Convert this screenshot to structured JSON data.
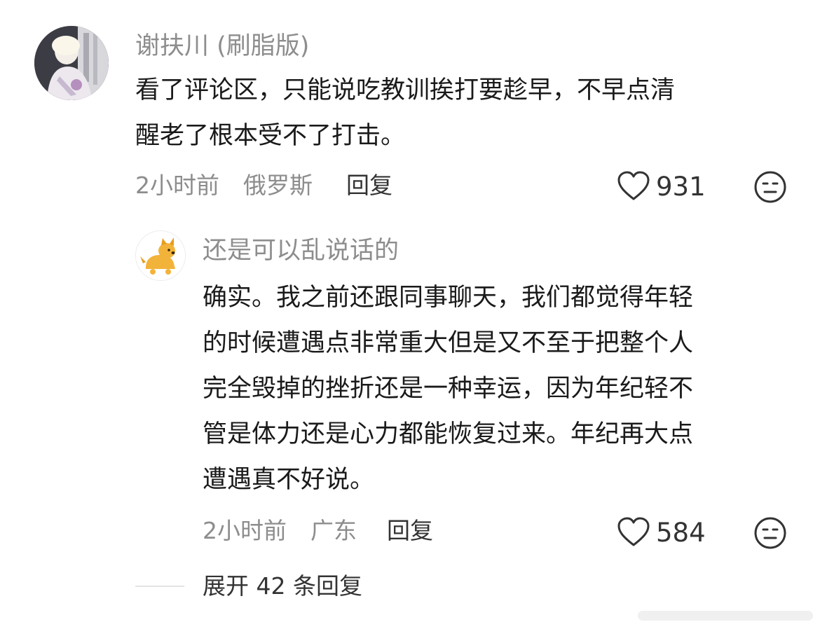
{
  "comments": [
    {
      "username": "谢扶川 (刷脂版)",
      "text_lines": [
        "看了评论区，只能说吃教训挨打要趁早，不早点清",
        "醒老了根本受不了打击。"
      ],
      "time": "2小时前",
      "location": "俄罗斯",
      "reply_label": "回复",
      "likes": "931",
      "like_icon": "heart-outline-icon",
      "reaction_icon": "neutral-face-icon"
    },
    {
      "username": "还是可以乱说话的",
      "text_lines": [
        "确实。我之前还跟同事聊天，我们都觉得年轻",
        "的时候遭遇点非常重大但是又不至于把整个人",
        "完全毁掉的挫折还是一种幸运，因为年纪轻不",
        "管是体力还是心力都能恢复过来。年纪再大点",
        "遭遇真不好说。"
      ],
      "time": "2小时前",
      "location": "广东",
      "reply_label": "回复",
      "likes": "584",
      "like_icon": "heart-outline-icon",
      "reaction_icon": "neutral-face-icon"
    }
  ],
  "expand_replies": "展开 42 条回复",
  "colors": {
    "secondary_text": "#8d8d8d",
    "primary_text": "#1a1a1a",
    "icon": "#333333"
  }
}
